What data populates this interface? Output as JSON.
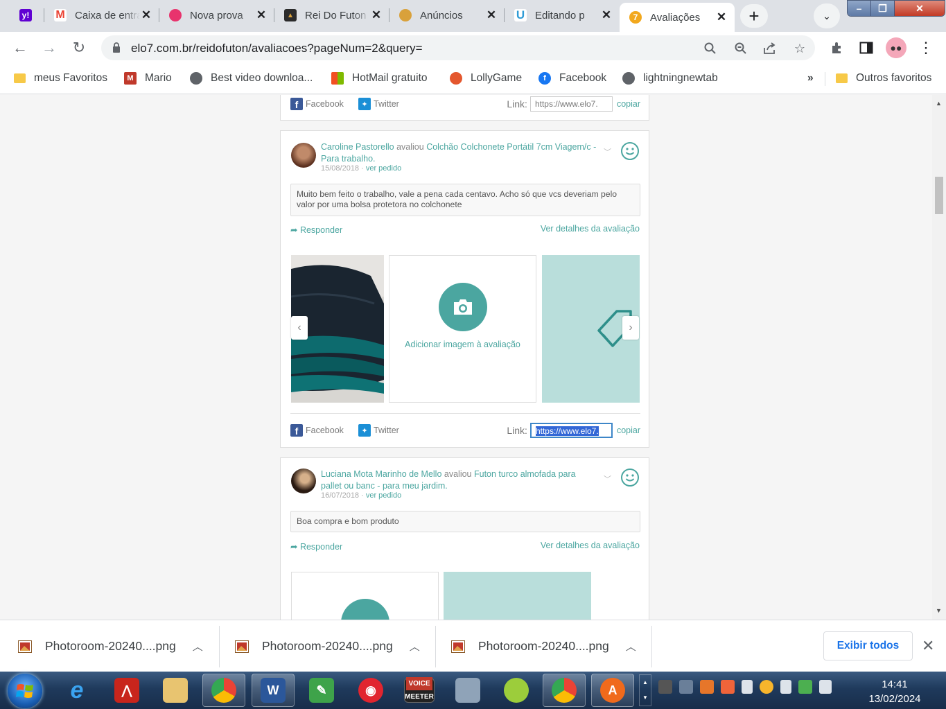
{
  "tabs": [
    {
      "title": "",
      "favicon": "yahoo-icon",
      "color": "#6001d2"
    },
    {
      "title": "Caixa de entrada",
      "favicon": "gmail-icon",
      "color": "#ea4335"
    },
    {
      "title": "Nova prova",
      "favicon": "petal-icon",
      "color": "#e8336d"
    },
    {
      "title": "Rei Do Futon",
      "favicon": "store-icon",
      "color": "#2b2b2b"
    },
    {
      "title": "Anúncios",
      "favicon": "burger-icon",
      "color": "#d9a13b"
    },
    {
      "title": "Editando p",
      "favicon": "u-icon",
      "color": "#2f9bd6"
    },
    {
      "title": "Avaliações",
      "favicon": "elo7-icon",
      "color": "#f2a81d"
    }
  ],
  "address": {
    "url": "elo7.com.br/reidofuton/avaliacoes?pageNum=2&query="
  },
  "bookmarks": [
    {
      "label": "meus Favoritos",
      "icon": "folder-icon"
    },
    {
      "label": "Mario",
      "icon": "mario-icon"
    },
    {
      "label": "Best video downloa...",
      "icon": "globe-icon"
    },
    {
      "label": "HotMail gratuito",
      "icon": "windows-icon"
    },
    {
      "label": "LollyGame",
      "icon": "lolly-icon"
    },
    {
      "label": "Facebook",
      "icon": "facebook-icon"
    },
    {
      "label": "lightningnewtab",
      "icon": "globe-icon"
    }
  ],
  "bookmarks_overflow": "»",
  "bookmarks_other": "Outros favoritos",
  "share": {
    "facebook": "Facebook",
    "twitter": "Twitter",
    "link_label": "Link:",
    "link_value": "https://www.elo7.",
    "copy": "copiar"
  },
  "reviews": [
    {
      "reviewer": "Caroline Pastorello",
      "verb": "avaliou",
      "product": "Colchão Colchonete Portátil 7cm Viagem/c - Para trabalho.",
      "date": "15/08/2018",
      "order_link": "ver pedido",
      "comment": "Muito bem feito o trabalho, vale a pena cada centavo. Acho só que vcs deveriam pelo valor por uma bolsa protetora no colchonete",
      "reply": "Responder",
      "details": "Ver detalhes da avaliação",
      "add_image": "Adicionar imagem à avaliação"
    },
    {
      "reviewer": "Luciana Mota Marinho de Mello",
      "verb": "avaliou",
      "product": "Futon turco almofada para pallet ou banc - para meu jardim.",
      "date": "16/07/2018",
      "order_link": "ver pedido",
      "comment": "Boa compra e bom produto",
      "reply": "Responder",
      "details": "Ver detalhes da avaliação"
    }
  ],
  "downloads": [
    {
      "name": "Photoroom-20240....png"
    },
    {
      "name": "Photoroom-20240....png"
    },
    {
      "name": "Photoroom-20240....png"
    }
  ],
  "downloads_show_all": "Exibir todos",
  "taskbar": {
    "apps": [
      "ie-icon",
      "acrobat-icon",
      "explorer-icon",
      "chrome-icon",
      "word-icon",
      "pen-icon",
      "camera-icon",
      "voicemeeter-icon",
      "photos-icon",
      "lime-icon",
      "chrome-profile-icon",
      "avast-icon"
    ],
    "voicemeeter_top": "VOICE",
    "voicemeeter_bottom": "MEETER",
    "time": "14:41",
    "date": "13/02/2024"
  },
  "colors": {
    "accent": "#4ba6a0",
    "teal_tile": "#b9dedb"
  }
}
